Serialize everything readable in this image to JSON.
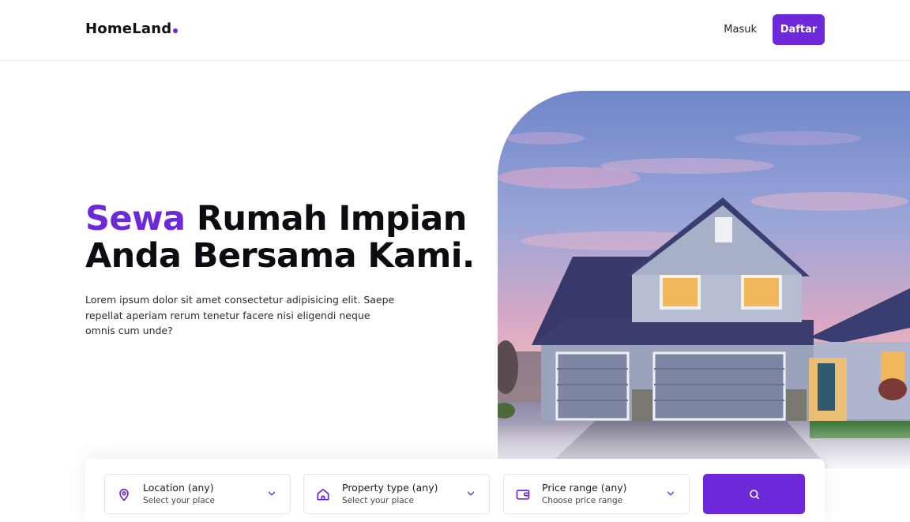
{
  "nav": {
    "logo": "HomeLand",
    "login_label": "Masuk",
    "register_label": "Daftar"
  },
  "hero": {
    "title_accent": "Sewa",
    "title_line1_rest": " Rumah Impian",
    "title_line2": "Anda Bersama Kami.",
    "description": "Lorem ipsum dolor sit amet consectetur adipisicing elit. Saepe repellat aperiam rerum tenetur facere nisi eligendi neque omnis cum unde?",
    "image_icon": "house-photo"
  },
  "search": {
    "filters": [
      {
        "title": "Location (any)",
        "subtitle": "Select your place",
        "icon": "map-pin-icon"
      },
      {
        "title": "Property type (any)",
        "subtitle": "Select your place",
        "icon": "home-icon"
      },
      {
        "title": "Price range (any)",
        "subtitle": "Choose price range",
        "icon": "wallet-icon"
      }
    ],
    "search_icon": "search-icon"
  },
  "colors": {
    "accent": "#6d28d9",
    "text": "#0b0b12",
    "border": "#e4e4ea"
  }
}
